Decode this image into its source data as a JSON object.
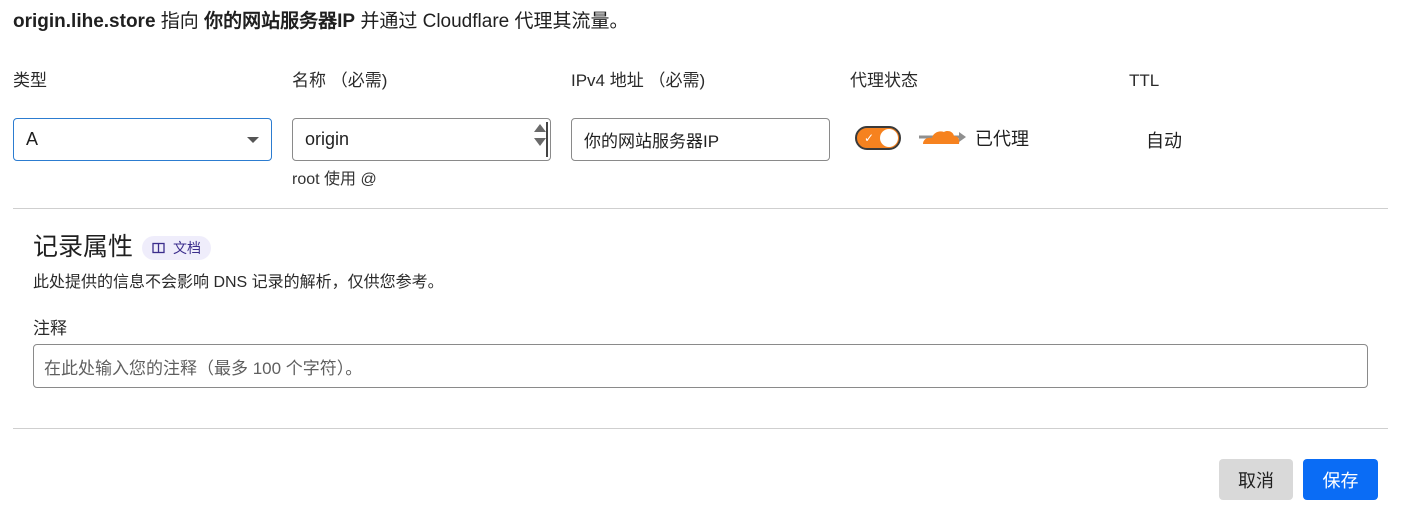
{
  "summary": {
    "host": "origin.lihe.store",
    "points_to": " 指向 ",
    "target": "你的网站服务器IP",
    "tail": " 并通过 Cloudflare 代理其流量。"
  },
  "columns": {
    "type": "类型",
    "name": "名称 （必需)",
    "ipv4": "IPv4 地址 （必需)",
    "proxy": "代理状态",
    "ttl": "TTL"
  },
  "fields": {
    "type_value": "A",
    "name_value": "origin",
    "name_hint": "root 使用 @",
    "ipv4_value": "你的网站服务器IP",
    "proxy_on": true,
    "proxy_label": "已代理",
    "ttl_value": "自动"
  },
  "attributes": {
    "title": "记录属性",
    "doc_badge": "文档",
    "description": "此处提供的信息不会影响 DNS 记录的解析，仅供您参考。",
    "comment_label": "注释",
    "comment_placeholder": "在此处输入您的注释（最多 100 个字符）。"
  },
  "actions": {
    "cancel": "取消",
    "save": "保存"
  },
  "colors": {
    "accent": "#0a6cf5",
    "proxy_orange": "#f6821f",
    "select_border": "#2c7cd0"
  }
}
